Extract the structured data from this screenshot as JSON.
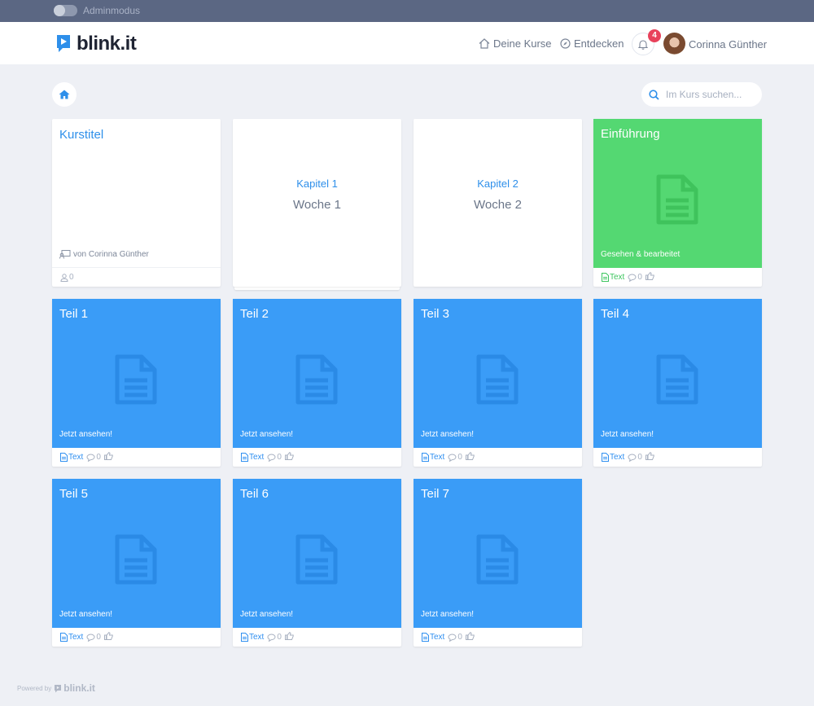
{
  "admin": {
    "label": "Adminmodus"
  },
  "header": {
    "logo_text": "blink.it",
    "nav": {
      "courses": "Deine Kurse",
      "discover": "Entdecken"
    },
    "notifications": "4",
    "user_name": "Corinna Günther"
  },
  "search": {
    "placeholder": "Im Kurs suchen..."
  },
  "course": {
    "title": "Kurstitel",
    "author": "von Corinna Günther",
    "members": "0"
  },
  "chapters": [
    {
      "chapter": "Kapitel 1",
      "week": "Woche 1"
    },
    {
      "chapter": "Kapitel 2",
      "week": "Woche 2"
    }
  ],
  "intro": {
    "title": "Einführung",
    "status": "Gesehen & bearbeitet",
    "type": "Text",
    "comments": "0"
  },
  "lessons": [
    {
      "title": "Teil 1",
      "status": "Jetzt ansehen!",
      "type": "Text",
      "comments": "0"
    },
    {
      "title": "Teil 2",
      "status": "Jetzt ansehen!",
      "type": "Text",
      "comments": "0"
    },
    {
      "title": "Teil 3",
      "status": "Jetzt ansehen!",
      "type": "Text",
      "comments": "0"
    },
    {
      "title": "Teil 4",
      "status": "Jetzt ansehen!",
      "type": "Text",
      "comments": "0"
    },
    {
      "title": "Teil 5",
      "status": "Jetzt ansehen!",
      "type": "Text",
      "comments": "0"
    },
    {
      "title": "Teil 6",
      "status": "Jetzt ansehen!",
      "type": "Text",
      "comments": "0"
    },
    {
      "title": "Teil 7",
      "status": "Jetzt ansehen!",
      "type": "Text",
      "comments": "0"
    }
  ],
  "footer": {
    "powered_by": "Powered by",
    "brand": "blink.it"
  },
  "colors": {
    "accent": "#2e8fea",
    "lesson": "#3a9cf7",
    "done": "#54d872",
    "badge": "#e8415b"
  }
}
